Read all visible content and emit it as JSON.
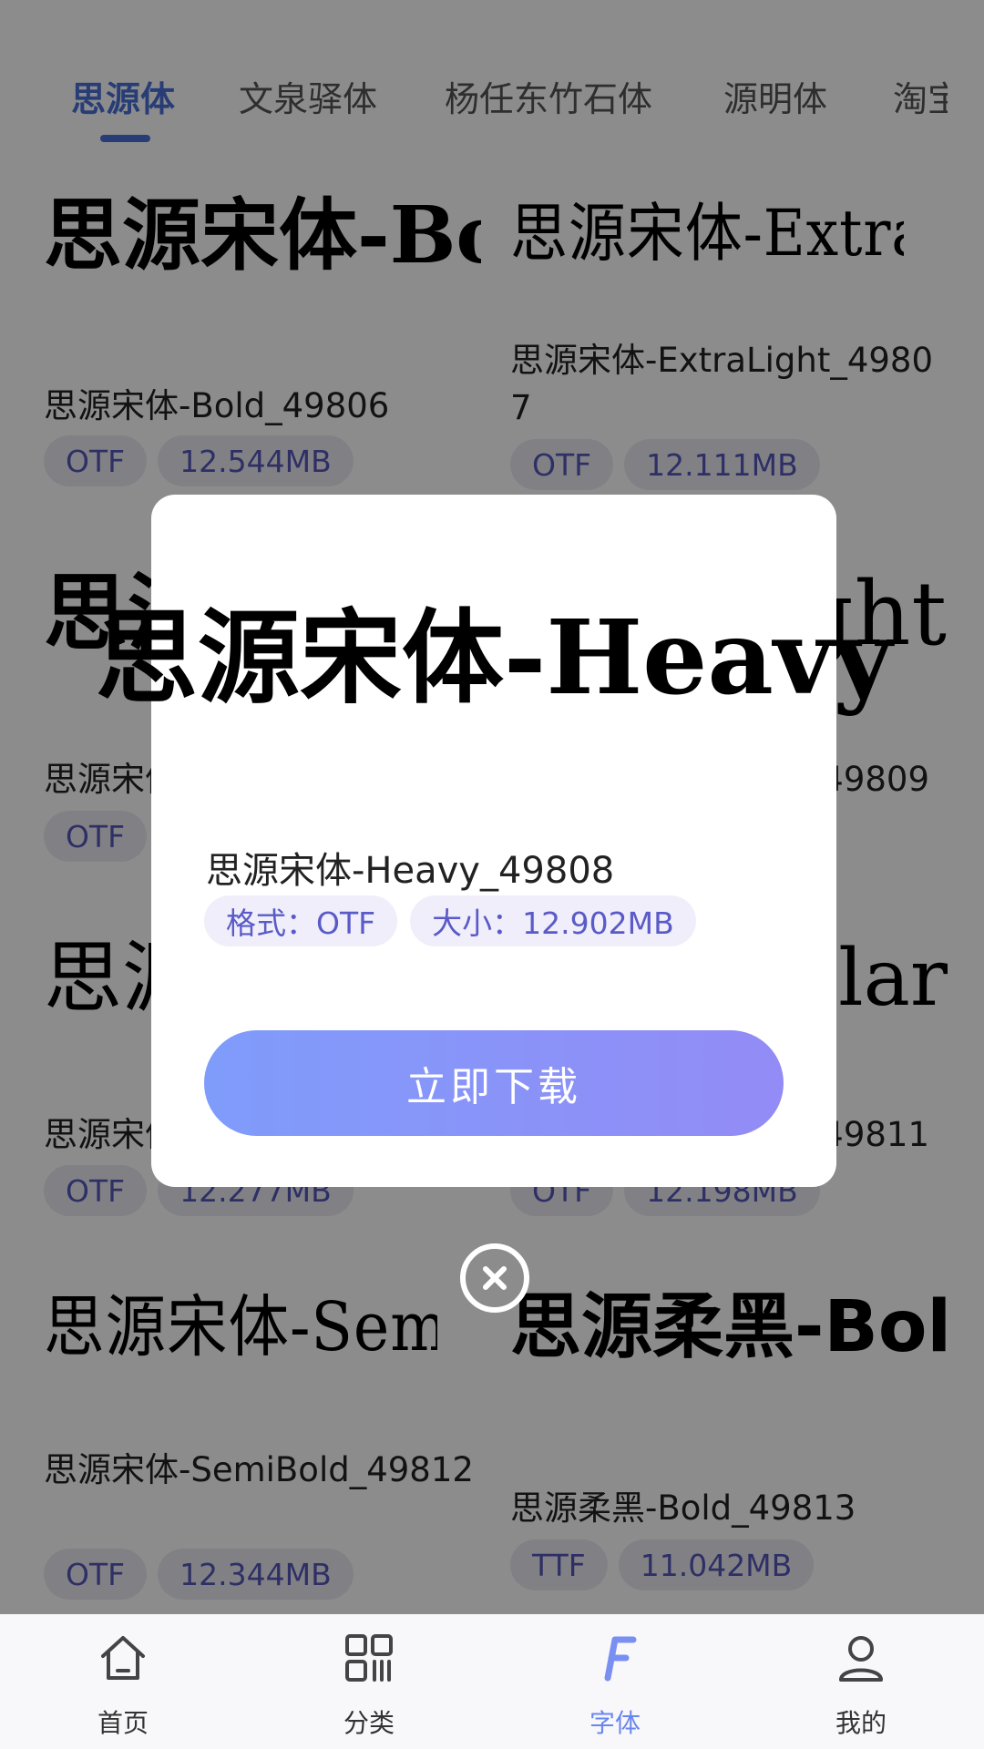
{
  "tabs": [
    {
      "label": "思源体",
      "active": true
    },
    {
      "label": "文泉驿体",
      "active": false
    },
    {
      "label": "杨任东竹石体",
      "active": false
    },
    {
      "label": "源明体",
      "active": false
    },
    {
      "label": "淘宝",
      "active": false
    }
  ],
  "fonts": [
    {
      "preview": "思源宋体-Bold",
      "name": "思源宋体-Bold_49806",
      "format": "OTF",
      "size": "12.544MB"
    },
    {
      "preview": "思源宋体-ExtraLight",
      "name": "思源宋体-ExtraLight_49807",
      "format": "OTF",
      "size": "12.111MB"
    },
    {
      "preview": "思源宋体-Heavy",
      "name": "思源宋体-Heavy_49808",
      "format": "OTF",
      "size": ""
    },
    {
      "preview": "思源宋体-Light",
      "name": "思源宋体-Light_49809",
      "format": "",
      "size": ""
    },
    {
      "preview": "思源宋体-Medium",
      "name": "思源宋体-Medium_49810",
      "format": "OTF",
      "size": "12.277MB"
    },
    {
      "preview": "思源宋体-Regular",
      "name": "思源宋体-Regular_49811",
      "format": "OTF",
      "size": "12.198MB"
    },
    {
      "preview": "思源宋体-SemiBold",
      "name": "思源宋体-SemiBold_49812",
      "format": "OTF",
      "size": "12.344MB"
    },
    {
      "preview": "思源柔黑-Bold",
      "name": "思源柔黑-Bold_49813",
      "format": "TTF",
      "size": "11.042MB"
    }
  ],
  "modal": {
    "preview": "思源宋体-Heavy",
    "name": "思源宋体-Heavy_49808",
    "format_chip": "格式：OTF",
    "size_chip": "大小：12.902MB",
    "download_label": "立即下载"
  },
  "bottom_nav": [
    {
      "label": "首页",
      "icon": "home-icon",
      "active": false
    },
    {
      "label": "分类",
      "icon": "category-icon",
      "active": false
    },
    {
      "label": "字体",
      "icon": "font-icon",
      "active": true
    },
    {
      "label": "我的",
      "icon": "profile-icon",
      "active": false
    }
  ],
  "colors": {
    "accent": "#4a6fd8",
    "chip_text": "#5457b8",
    "button_start": "#7f9cfb",
    "button_end": "#938bf6"
  }
}
